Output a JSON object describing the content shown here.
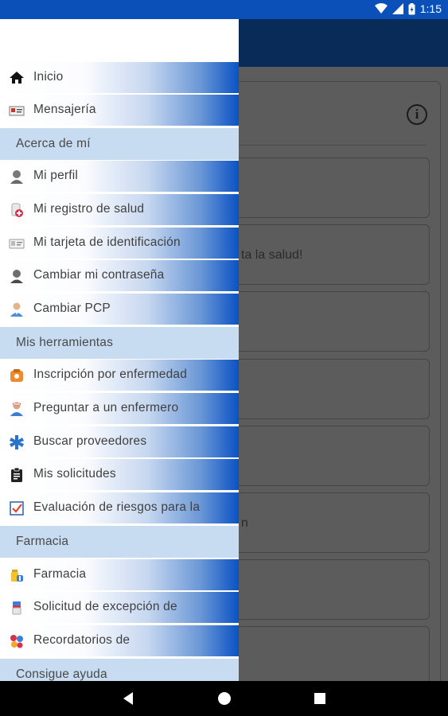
{
  "status_bar": {
    "time": "1:15"
  },
  "colors": {
    "status_bar": "#0a50b8",
    "app_bar": "#082b57",
    "section_bg": "#c7dbf1",
    "scrim": "#5c5c5c"
  },
  "background": {
    "card_texts": [
      "ta la salud!",
      "n"
    ]
  },
  "drawer": {
    "items": [
      {
        "type": "item",
        "label": "Inicio",
        "icon": "home-icon"
      },
      {
        "type": "item",
        "label": "Mensajería",
        "icon": "messages-icon"
      },
      {
        "type": "section",
        "label": "Acerca de mí"
      },
      {
        "type": "item",
        "label": "Mi perfil",
        "icon": "profile-icon"
      },
      {
        "type": "item",
        "label": "Mi registro de salud",
        "icon": "health-record-icon"
      },
      {
        "type": "item",
        "label": "Mi tarjeta de identificación",
        "icon": "id-card-icon"
      },
      {
        "type": "item",
        "label": "Cambiar mi contraseña",
        "icon": "password-user-icon"
      },
      {
        "type": "item",
        "label": "Cambiar PCP",
        "icon": "doctor-icon"
      },
      {
        "type": "section",
        "label": "Mis herramientas"
      },
      {
        "type": "item",
        "label": "Inscripción por enfermedad",
        "icon": "enrollment-icon"
      },
      {
        "type": "item",
        "label": "Preguntar a un enfermero",
        "icon": "nurse-icon"
      },
      {
        "type": "item",
        "label": "Buscar proveedores",
        "icon": "providers-icon"
      },
      {
        "type": "item",
        "label": "Mis solicitudes",
        "icon": "clipboard-icon"
      },
      {
        "type": "item",
        "label": "Evaluación de riesgos para la",
        "icon": "checklist-icon"
      },
      {
        "type": "section",
        "label": "Farmacia"
      },
      {
        "type": "item",
        "label": "Farmacia",
        "icon": "pharmacy-icon"
      },
      {
        "type": "item",
        "label": "Solicitud de excepción de",
        "icon": "exception-icon"
      },
      {
        "type": "item",
        "label": "Recordatorios de",
        "icon": "pills-icon"
      },
      {
        "type": "section",
        "label": "Consigue ayuda"
      }
    ]
  }
}
